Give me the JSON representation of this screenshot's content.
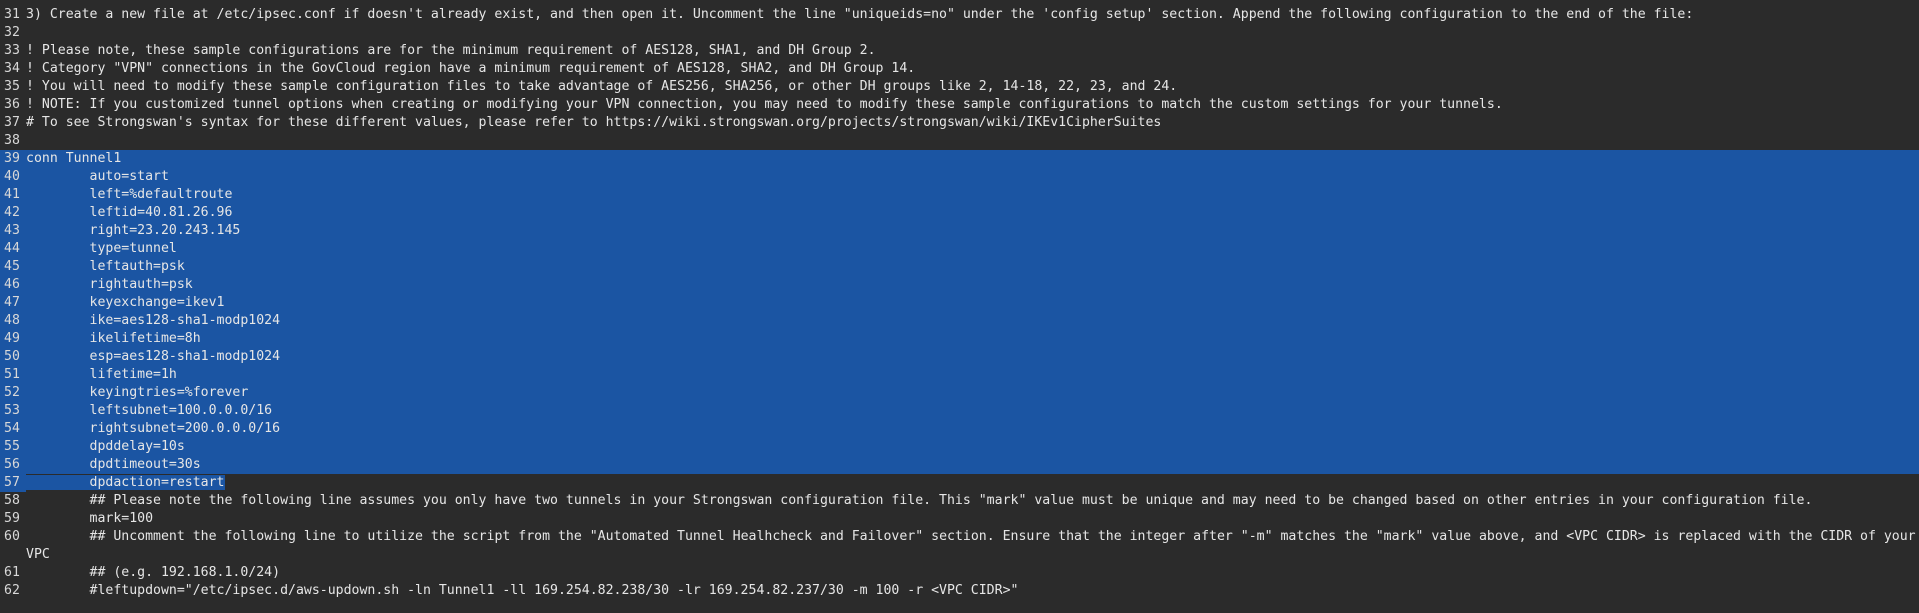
{
  "editor": {
    "lines": [
      {
        "num": "31",
        "text": "3) Create a new file at /etc/ipsec.conf if doesn't already exist, and then open it. Uncomment the line \"uniqueids=no\" under the 'config setup' section. Append the following configuration to the end of the file:",
        "selected": "none"
      },
      {
        "num": "32",
        "text": "",
        "selected": "none"
      },
      {
        "num": "33",
        "text": "! Please note, these sample configurations are for the minimum requirement of AES128, SHA1, and DH Group 2.",
        "selected": "none"
      },
      {
        "num": "34",
        "text": "! Category \"VPN\" connections in the GovCloud region have a minimum requirement of AES128, SHA2, and DH Group 14.",
        "selected": "none"
      },
      {
        "num": "35",
        "text": "! You will need to modify these sample configuration files to take advantage of AES256, SHA256, or other DH groups like 2, 14-18, 22, 23, and 24.",
        "selected": "none"
      },
      {
        "num": "36",
        "text": "! NOTE: If you customized tunnel options when creating or modifying your VPN connection, you may need to modify these sample configurations to match the custom settings for your tunnels.",
        "selected": "none"
      },
      {
        "num": "37",
        "text": "# To see Strongswan's syntax for these different values, please refer to https://wiki.strongswan.org/projects/strongswan/wiki/IKEv1CipherSuites",
        "selected": "none"
      },
      {
        "num": "38",
        "text": "",
        "selected": "none"
      },
      {
        "num": "39",
        "text": "conn Tunnel1",
        "selected": "full"
      },
      {
        "num": "40",
        "text": "        auto=start",
        "selected": "full"
      },
      {
        "num": "41",
        "text": "        left=%defaultroute",
        "selected": "full"
      },
      {
        "num": "42",
        "text": "        leftid=40.81.26.96",
        "selected": "full"
      },
      {
        "num": "43",
        "text": "        right=23.20.243.145",
        "selected": "full"
      },
      {
        "num": "44",
        "text": "        type=tunnel",
        "selected": "full"
      },
      {
        "num": "45",
        "text": "        leftauth=psk",
        "selected": "full"
      },
      {
        "num": "46",
        "text": "        rightauth=psk",
        "selected": "full"
      },
      {
        "num": "47",
        "text": "        keyexchange=ikev1",
        "selected": "full"
      },
      {
        "num": "48",
        "text": "        ike=aes128-sha1-modp1024",
        "selected": "full"
      },
      {
        "num": "49",
        "text": "        ikelifetime=8h",
        "selected": "full"
      },
      {
        "num": "50",
        "text": "        esp=aes128-sha1-modp1024",
        "selected": "full"
      },
      {
        "num": "51",
        "text": "        lifetime=1h",
        "selected": "full"
      },
      {
        "num": "52",
        "text": "        keyingtries=%forever",
        "selected": "full"
      },
      {
        "num": "53",
        "text": "        leftsubnet=100.0.0.0/16",
        "selected": "full"
      },
      {
        "num": "54",
        "text": "        rightsubnet=200.0.0.0/16",
        "selected": "full"
      },
      {
        "num": "55",
        "text": "        dpddelay=10s",
        "selected": "full"
      },
      {
        "num": "56",
        "text": "        dpdtimeout=30s",
        "selected": "full"
      },
      {
        "num": "57",
        "text": "        dpdaction=restart",
        "selected": "partial"
      },
      {
        "num": "58",
        "text": "        ## Please note the following line assumes you only have two tunnels in your Strongswan configuration file. This \"mark\" value must be unique and may need to be changed based on other entries in your configuration file.",
        "selected": "none"
      },
      {
        "num": "59",
        "text": "        mark=100",
        "selected": "none"
      },
      {
        "num": "60",
        "text": "        ## Uncomment the following line to utilize the script from the \"Automated Tunnel Healhcheck and Failover\" section. Ensure that the integer after \"-m\" matches the \"mark\" value above, and <VPC CIDR> is replaced with the CIDR of your VPC",
        "selected": "none",
        "wrap": true
      },
      {
        "num": "61",
        "text": "        ## (e.g. 192.168.1.0/24)",
        "selected": "none"
      },
      {
        "num": "62",
        "text": "        #leftupdown=\"/etc/ipsec.d/aws-updown.sh -ln Tunnel1 -ll 169.254.82.238/30 -lr 169.254.82.237/30 -m 100 -r <VPC CIDR>\"",
        "selected": "none"
      }
    ]
  }
}
